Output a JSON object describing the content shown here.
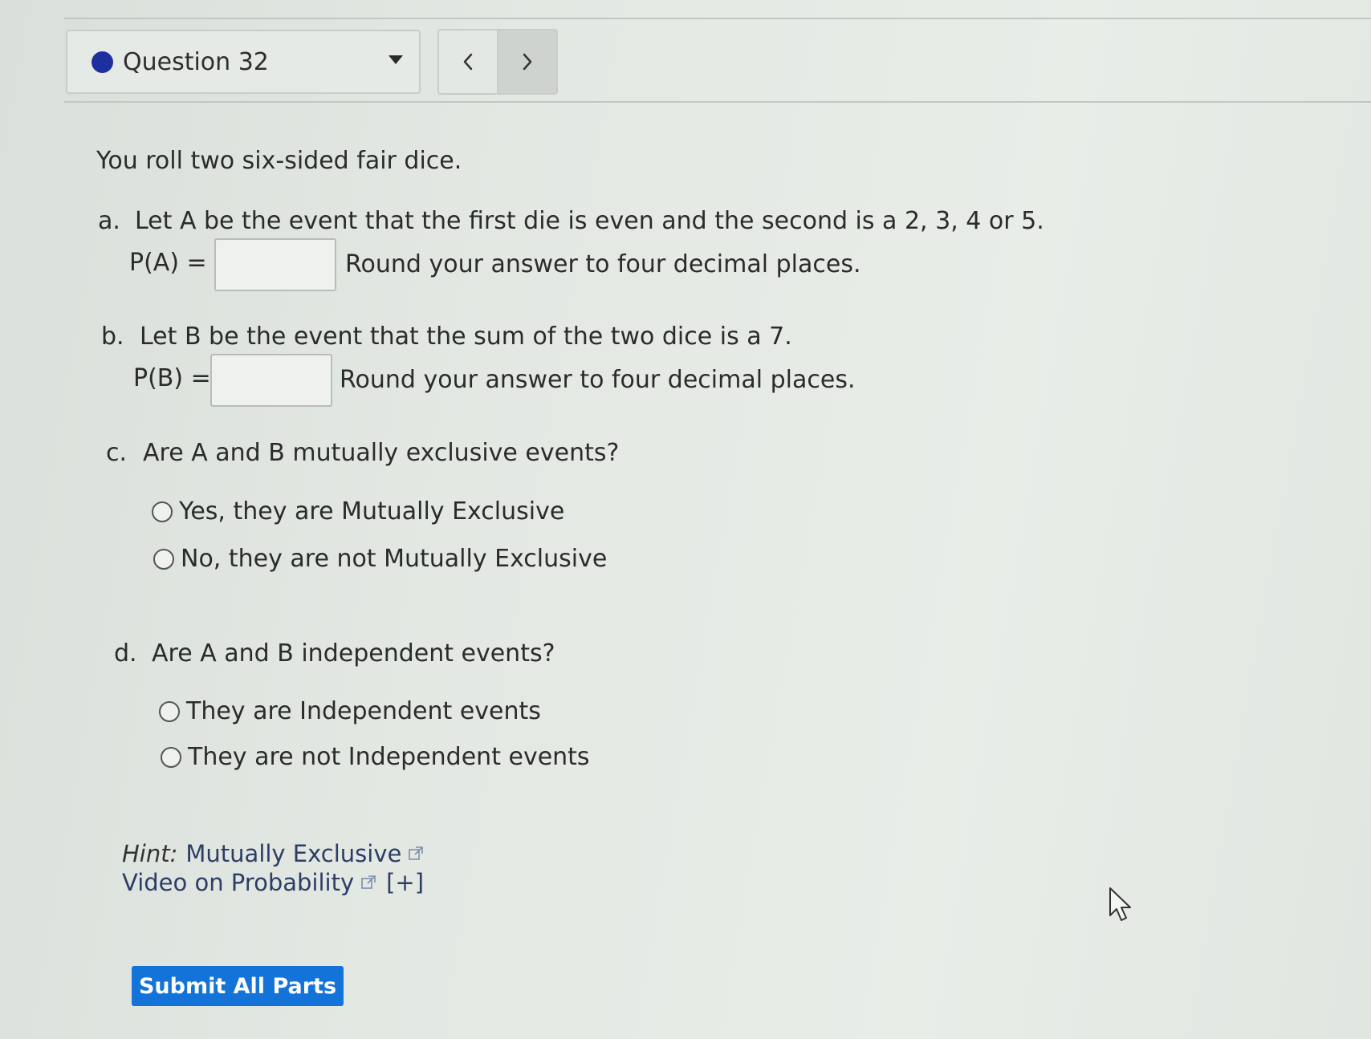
{
  "header": {
    "question_label": "Question 32",
    "status_color": "#1e2fa0"
  },
  "question": {
    "intro": "You roll two six-sided fair dice.",
    "part_a": {
      "letter": "a.",
      "text": "Let A be the event that the first die is even and the second is a 2, 3, 4 or 5.",
      "answer_label": "P(A) =",
      "answer_value": "",
      "instruction": "Round your answer to four decimal places."
    },
    "part_b": {
      "letter": "b.",
      "text": "Let B be the event that the sum of the two dice is a 7.",
      "answer_label": "P(B) =",
      "answer_value": "",
      "instruction": "Round your answer to four decimal places."
    },
    "part_c": {
      "letter": "c.",
      "text": "Are A and B mutually exclusive events?",
      "options": [
        "Yes, they are Mutually Exclusive",
        "No, they are not Mutually Exclusive"
      ]
    },
    "part_d": {
      "letter": "d.",
      "text": "Are A and B independent events?",
      "options": [
        "They are Independent events",
        "They are not Independent events"
      ]
    }
  },
  "hints": {
    "prefix": "Hint:",
    "link1": "Mutually Exclusive",
    "link2": "Video on Probability",
    "expand": "[+]"
  },
  "submit_label": "Submit All Parts",
  "colors": {
    "submit_bg": "#1473d8",
    "link": "#2c3e66"
  }
}
